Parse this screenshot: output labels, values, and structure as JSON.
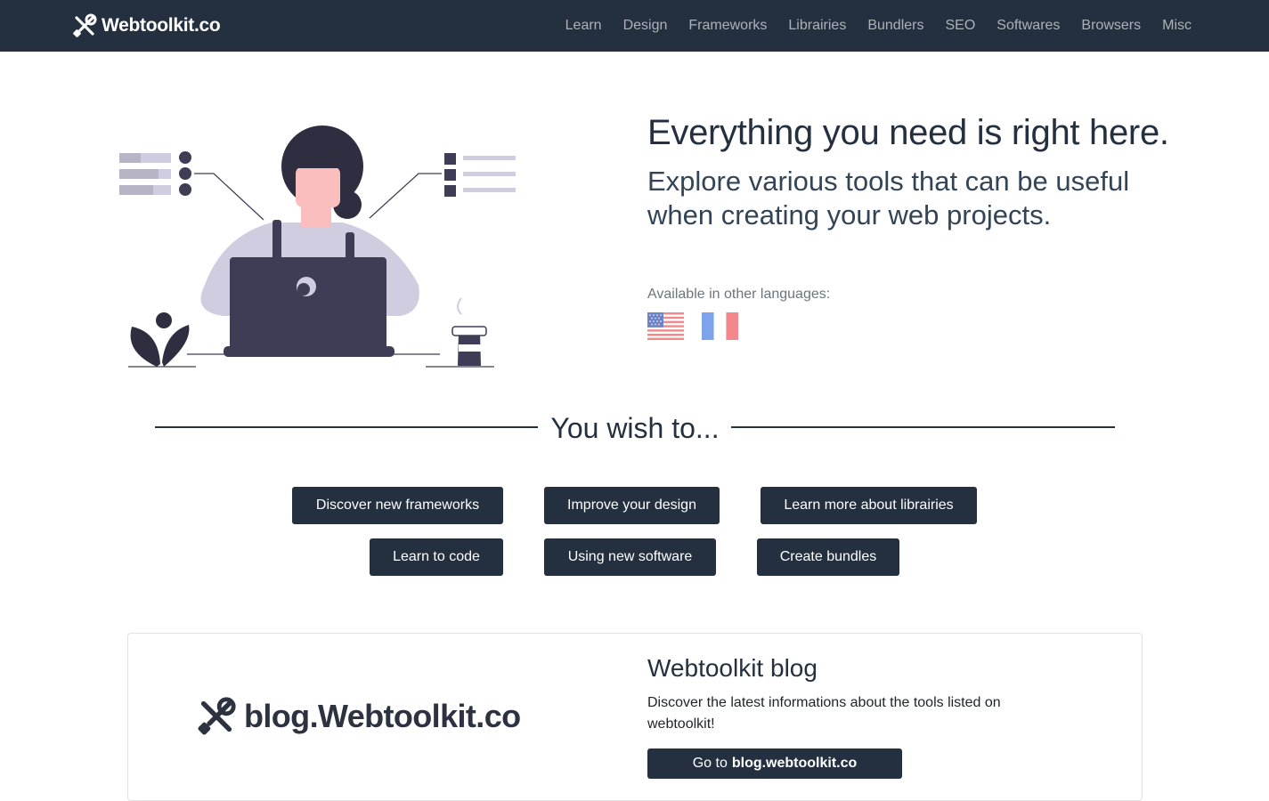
{
  "navbar": {
    "brand": "Webtoolkit.co",
    "links": [
      "Learn",
      "Design",
      "Frameworks",
      "Librairies",
      "Bundlers",
      "SEO",
      "Softwares",
      "Browsers",
      "Misc"
    ]
  },
  "hero": {
    "title": "Everything you need is right here.",
    "subtitle": "Explore various tools that can be useful when creating your web projects.",
    "languages_label": "Available in other languages:",
    "flags": [
      "us-flag-icon",
      "fr-flag-icon"
    ]
  },
  "wish": {
    "title": "You wish to..."
  },
  "actions": [
    "Discover new frameworks",
    "Improve your design",
    "Learn more about librairies",
    "Learn to code",
    "Using new software",
    "Create bundles"
  ],
  "blog": {
    "logo_text": "blog.Webtoolkit.co",
    "title": "Webtoolkit blog",
    "description": "Discover the latest informations about the tools listed on webtoolkit!",
    "button_prefix": "Go to",
    "button_link": "blog.webtoolkit.co"
  },
  "colors": {
    "navbar": "#243040",
    "button": "#243040",
    "accent_illustration": "#3f3d56",
    "illustration_light": "#d0cde1"
  }
}
